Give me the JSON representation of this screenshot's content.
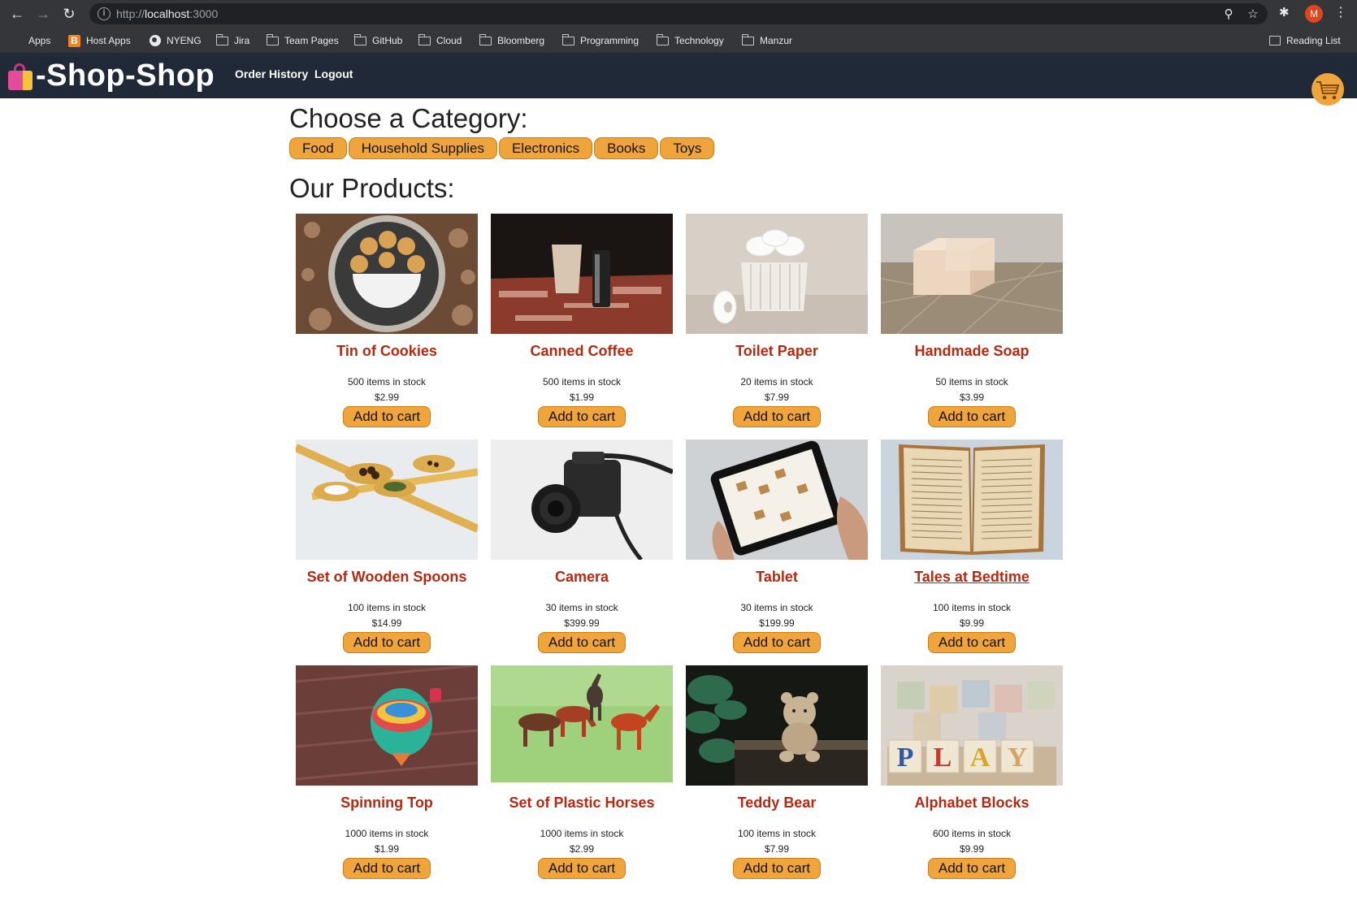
{
  "browser": {
    "url_prefix": "http://",
    "url_host": "localhost",
    "url_port": ":3000",
    "avatar_letter": "M",
    "bookmarks": [
      {
        "label": "Apps",
        "icon": "apps-icon"
      },
      {
        "label": "Host Apps",
        "icon": "blogger-icon"
      },
      {
        "label": "NYENG",
        "icon": "globe-icon"
      },
      {
        "label": "Jira",
        "icon": "folder-icon"
      },
      {
        "label": "Team Pages",
        "icon": "folder-icon"
      },
      {
        "label": "GitHub",
        "icon": "folder-icon"
      },
      {
        "label": "Cloud",
        "icon": "folder-icon"
      },
      {
        "label": "Bloomberg",
        "icon": "folder-icon"
      },
      {
        "label": "Programming",
        "icon": "folder-icon"
      },
      {
        "label": "Technology",
        "icon": "folder-icon"
      },
      {
        "label": "Manzur",
        "icon": "folder-icon"
      }
    ],
    "reading_list": "Reading List"
  },
  "header": {
    "brand": "-Shop-Shop",
    "nav": [
      "Order History",
      "Logout"
    ]
  },
  "colors": {
    "accent": "#f0a53c",
    "header_bg": "#1f2937",
    "product_name": "#b32a12"
  },
  "categories": {
    "title": "Choose a Category:",
    "items": [
      "Food",
      "Household Supplies",
      "Electronics",
      "Books",
      "Toys"
    ]
  },
  "products": {
    "title": "Our Products:",
    "add_label": "Add to cart",
    "items": [
      {
        "name": "Tin of Cookies",
        "stock": "500 items in stock",
        "price": "$2.99"
      },
      {
        "name": "Canned Coffee",
        "stock": "500 items in stock",
        "price": "$1.99"
      },
      {
        "name": "Toilet Paper",
        "stock": "20 items in stock",
        "price": "$7.99"
      },
      {
        "name": "Handmade Soap",
        "stock": "50 items in stock",
        "price": "$3.99"
      },
      {
        "name": "Set of Wooden Spoons",
        "stock": "100 items in stock",
        "price": "$14.99"
      },
      {
        "name": "Camera",
        "stock": "30 items in stock",
        "price": "$399.99"
      },
      {
        "name": "Tablet",
        "stock": "30 items in stock",
        "price": "$199.99"
      },
      {
        "name": "Tales at Bedtime",
        "stock": "100 items in stock",
        "price": "$9.99"
      },
      {
        "name": "Spinning Top",
        "stock": "1000 items in stock",
        "price": "$1.99"
      },
      {
        "name": "Set of Plastic Horses",
        "stock": "1000 items in stock",
        "price": "$2.99"
      },
      {
        "name": "Teddy Bear",
        "stock": "100 items in stock",
        "price": "$7.99"
      },
      {
        "name": "Alphabet Blocks",
        "stock": "600 items in stock",
        "price": "$9.99"
      }
    ]
  }
}
